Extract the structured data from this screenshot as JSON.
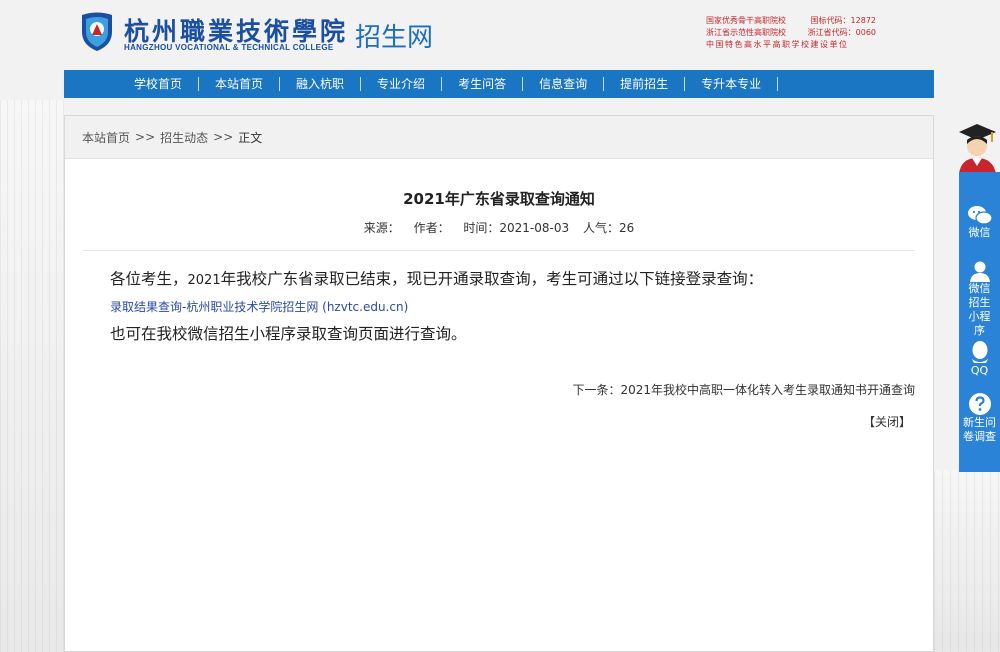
{
  "header": {
    "logo_cn": "杭州職業技術學院",
    "logo_en": "HANGZHOU VOCATIONAL & TECHNICAL COLLEGE",
    "site_name": "招生网",
    "badges": [
      {
        "label": "国家优秀骨干高职院校",
        "code": "国标代码：12872"
      },
      {
        "label": "浙江省示范性高职院校",
        "code": "浙江省代码：0060"
      }
    ],
    "badge_wide": "中国特色高水平高职学校建设单位"
  },
  "nav": {
    "items": [
      {
        "label": "学校首页"
      },
      {
        "label": "本站首页"
      },
      {
        "label": "融入杭职"
      },
      {
        "label": "专业介绍"
      },
      {
        "label": "考生问答"
      },
      {
        "label": "信息查询"
      },
      {
        "label": "提前招生"
      },
      {
        "label": "专升本专业"
      }
    ]
  },
  "breadcrumb": {
    "home": "本站首页",
    "sep": ">>",
    "section": "招生动态",
    "current": "正文"
  },
  "article": {
    "title": "2021年广东省录取查询通知",
    "meta_source": "来源：",
    "meta_author": "作者：",
    "meta_time": "时间：2021-08-03",
    "meta_views": "人气：26",
    "para1_pre": "各位考生，",
    "para1_num": "2021",
    "para1_post": "年我校广东省录取已结束，现已开通录取查询，考生可通过以下链接登录查询：",
    "link_text": "录取结果查询-杭州职业技术学院招生网 (hzvtc.edu.cn)",
    "para2": "也可在我校微信招生小程序录取查询页面进行查询。",
    "next_prefix": "下一条：",
    "next_title": "2021年我校中高职一体化转入考生录取通知书开通查询",
    "close_label": "【关闭】"
  },
  "float_panel": {
    "items": [
      {
        "label": "微信",
        "icon": "wechat-icon"
      },
      {
        "label": "微信招生小程序",
        "icon": "user-icon"
      },
      {
        "label": "QQ",
        "icon": "qq-icon"
      },
      {
        "label": "新生问卷调查",
        "icon": "question-icon"
      }
    ]
  },
  "colors": {
    "nav_bg": "#1a75c2",
    "brand_blue": "#1b4fa0",
    "badge_red": "#c8252c",
    "float_panel_bg": "#2a83d6"
  }
}
